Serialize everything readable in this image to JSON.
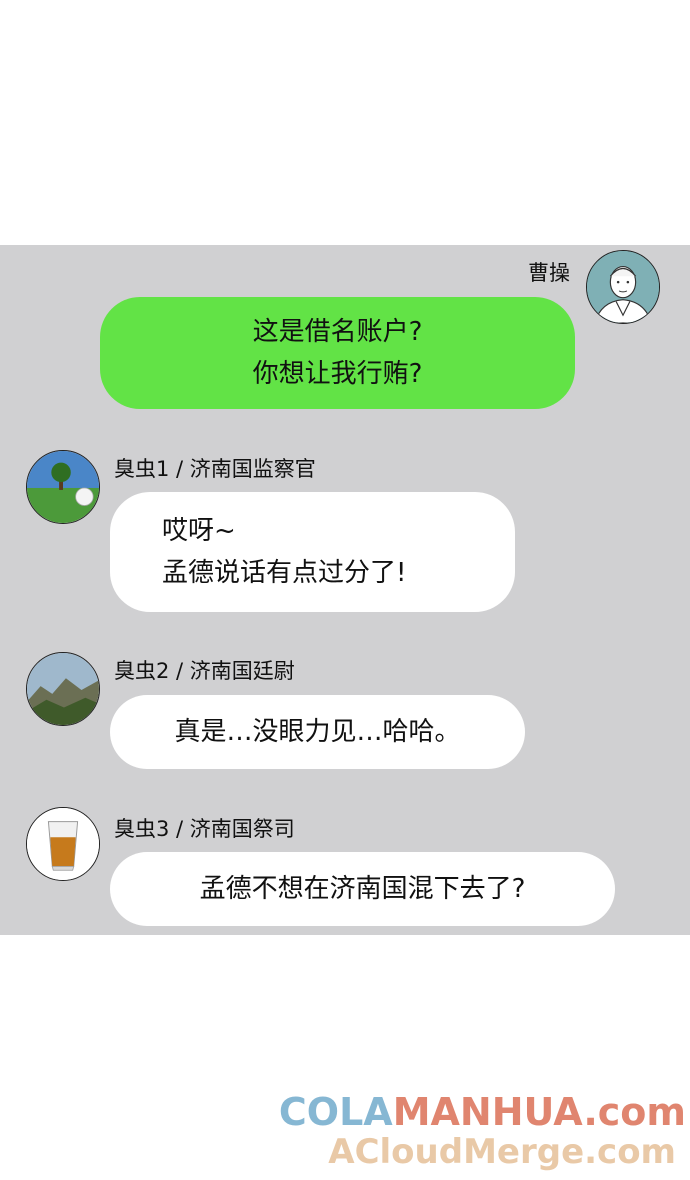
{
  "messages": [
    {
      "sender": "曹操",
      "lines": [
        "这是借名账户?",
        "你想让我行贿?"
      ],
      "avatar_icon": "old-man-portrait-icon",
      "bubble_color": "#62e346"
    },
    {
      "sender": "臭虫1 / 济南国监察官",
      "lines": [
        "哎呀~",
        "孟德说话有点过分了!"
      ],
      "avatar_icon": "golf-course-icon",
      "bubble_color": "#ffffff"
    },
    {
      "sender": "臭虫2 / 济南国廷尉",
      "lines": [
        "真是…没眼力见…哈哈。"
      ],
      "avatar_icon": "mountain-landscape-icon",
      "bubble_color": "#ffffff"
    },
    {
      "sender": "臭虫3 / 济南国祭司",
      "lines": [
        "孟德不想在济南国混下去了?"
      ],
      "avatar_icon": "whiskey-glass-icon",
      "bubble_color": "#ffffff"
    }
  ],
  "watermark": {
    "line1_a": "COLA",
    "line1_b": "MANHUA.com",
    "line2": "ACloudMerge.com"
  },
  "colors": {
    "chat_background": "#d0d0d2",
    "self_bubble": "#62e346",
    "other_bubble": "#ffffff"
  }
}
